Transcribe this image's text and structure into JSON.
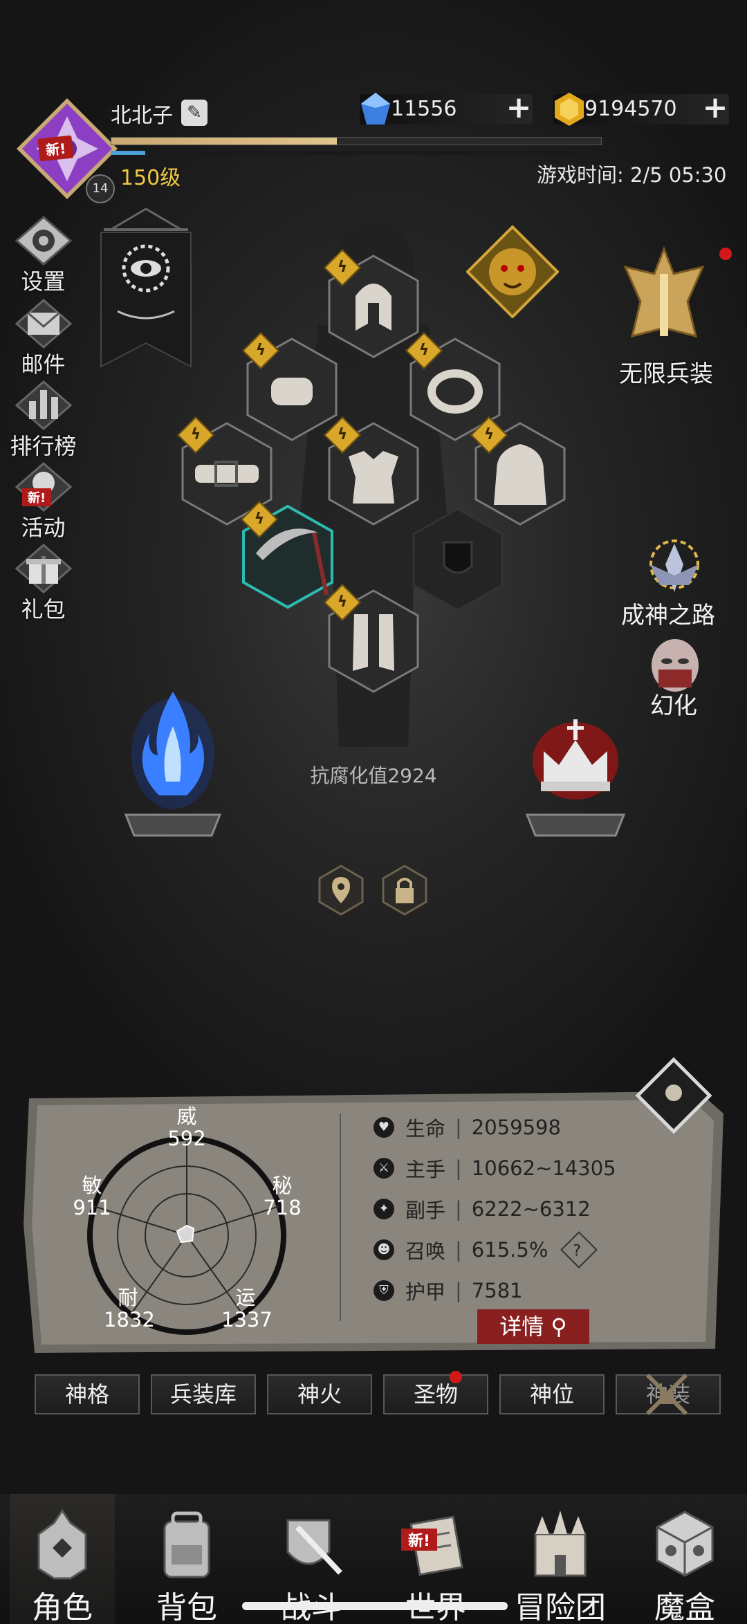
{
  "header": {
    "player_name": "北北子",
    "level_label": "150级",
    "avatar_level": "14",
    "avatar_new_tag": "新!",
    "exp_fraction": 0.46,
    "mp_fraction": 0.07,
    "gems": "11556",
    "gold": "9194570",
    "game_time": "游戏时间: 2/5 05:30"
  },
  "left_menu": [
    {
      "label": "设置",
      "icon": "gear-icon"
    },
    {
      "label": "邮件",
      "icon": "mail-icon"
    },
    {
      "label": "排行榜",
      "icon": "ranking-icon"
    },
    {
      "label": "活动",
      "icon": "event-icon",
      "new_tag": "新!"
    },
    {
      "label": "礼包",
      "icon": "gift-icon"
    }
  ],
  "right_menu": {
    "infinite_gear": "无限兵装",
    "god_path": "成神之路",
    "transform": "幻化"
  },
  "corruption": "抗腐化值2924",
  "attributes": {
    "wei": {
      "name": "威",
      "value": "592"
    },
    "mi": {
      "name": "秘",
      "value": "718"
    },
    "min": {
      "name": "敏",
      "value": "911"
    },
    "nai": {
      "name": "耐",
      "value": "1832"
    },
    "yun": {
      "name": "运",
      "value": "1337"
    }
  },
  "stats": [
    {
      "name": "生命",
      "value": "2059598",
      "icon": "heart-icon"
    },
    {
      "name": "主手",
      "value": "10662~14305",
      "icon": "sword-icon"
    },
    {
      "name": "副手",
      "value": "6222~6312",
      "icon": "offhand-icon"
    },
    {
      "name": "召唤",
      "value": "615.5%",
      "icon": "summon-icon"
    },
    {
      "name": "护甲",
      "value": "7581",
      "icon": "armor-icon"
    }
  ],
  "summon_help": "?",
  "detail_button": "详情",
  "tabs": [
    "神格",
    "兵装库",
    "神火",
    "圣物",
    "神位",
    "神装"
  ],
  "nav": [
    {
      "label": "角色",
      "icon": "helmet-icon"
    },
    {
      "label": "背包",
      "icon": "backpack-icon"
    },
    {
      "label": "战斗",
      "icon": "battle-icon"
    },
    {
      "label": "世界",
      "icon": "scroll-icon",
      "new_tag": "新!"
    },
    {
      "label": "冒险团",
      "icon": "castle-icon"
    },
    {
      "label": "魔盒",
      "icon": "cube-icon"
    }
  ],
  "colors": {
    "gold_text": "#f1c842",
    "accent_red": "#8a1f1f",
    "exp": "#c9a873"
  }
}
